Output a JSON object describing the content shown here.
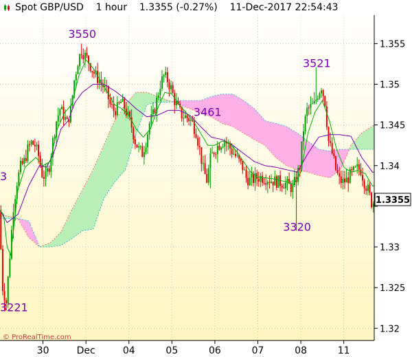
{
  "header": {
    "symbol": "Spot GBP/USD",
    "timeframe": "1 hour",
    "price_change": "1.3355 (-0.27%)",
    "datetime": "11-Dec-2017 22:54:43"
  },
  "watermark": "© ProRealTime.com",
  "last_price_label": "1.3355",
  "colors": {
    "up_candle": "#00a000",
    "down_candle": "#e00000",
    "kijun": "#7a00b0",
    "tenkan": "#00b000",
    "cloud_bull": "#b8f0b8",
    "cloud_bear": "#ffb0e6",
    "senkou_a": "#ff7070",
    "senkou_b": "#40c0e0",
    "background_top": "#ffffff",
    "background_bottom": "#fff5c0",
    "annotation": "#7a00b0"
  },
  "chart_data": {
    "type": "candlestick",
    "title": "Spot GBP/USD",
    "ylim": [
      1.3185,
      1.3585
    ],
    "y_ticks": [
      1.32,
      1.325,
      1.33,
      1.335,
      1.34,
      1.345,
      1.35,
      1.355
    ],
    "y_tick_labels": [
      "1.32",
      "1.325",
      "1.33",
      "",
      "1.34",
      "1.345",
      "1.35",
      "1.355"
    ],
    "x_labels": [
      {
        "label": "30",
        "hour": 24
      },
      {
        "label": "Dec",
        "hour": 48
      },
      {
        "label": "04",
        "hour": 72
      },
      {
        "label": "05",
        "hour": 96
      },
      {
        "label": "06",
        "hour": 120
      },
      {
        "label": "07",
        "hour": 144
      },
      {
        "label": "08",
        "hour": 168
      },
      {
        "label": "11",
        "hour": 192
      }
    ],
    "x_range_hours": [
      0,
      209
    ],
    "annotations": [
      {
        "label": "3550",
        "hour": 45,
        "price": 1.3557
      },
      {
        "label": "3221",
        "hour": 2,
        "price": 1.3221
      },
      {
        "label": "3461",
        "hour": 115,
        "price": 1.3461
      },
      {
        "label": "3320",
        "hour": 165,
        "price": 1.332
      },
      {
        "label": "3521",
        "hour": 176,
        "price": 1.3521
      },
      {
        "label": "3",
        "hour": 0,
        "price": 1.3382
      }
    ],
    "last_price": 1.3355,
    "close_path": [
      [
        0,
        1.3345
      ],
      [
        2,
        1.325
      ],
      [
        4,
        1.3232
      ],
      [
        6,
        1.329
      ],
      [
        8,
        1.335
      ],
      [
        10,
        1.338
      ],
      [
        12,
        1.3398
      ],
      [
        14,
        1.3405
      ],
      [
        16,
        1.342
      ],
      [
        18,
        1.3428
      ],
      [
        20,
        1.3425
      ],
      [
        22,
        1.3412
      ],
      [
        24,
        1.339
      ],
      [
        26,
        1.3385
      ],
      [
        28,
        1.34
      ],
      [
        30,
        1.343
      ],
      [
        32,
        1.3455
      ],
      [
        34,
        1.347
      ],
      [
        36,
        1.3462
      ],
      [
        38,
        1.3452
      ],
      [
        40,
        1.3468
      ],
      [
        42,
        1.3505
      ],
      [
        44,
        1.3528
      ],
      [
        46,
        1.3542
      ],
      [
        48,
        1.3535
      ],
      [
        50,
        1.3528
      ],
      [
        52,
        1.3518
      ],
      [
        54,
        1.351
      ],
      [
        56,
        1.3505
      ],
      [
        58,
        1.3498
      ],
      [
        60,
        1.349
      ],
      [
        62,
        1.3475
      ],
      [
        64,
        1.3468
      ],
      [
        66,
        1.347
      ],
      [
        68,
        1.3478
      ],
      [
        70,
        1.3472
      ],
      [
        72,
        1.346
      ],
      [
        74,
        1.3448
      ],
      [
        76,
        1.343
      ],
      [
        78,
        1.342
      ],
      [
        80,
        1.3415
      ],
      [
        82,
        1.343
      ],
      [
        84,
        1.3452
      ],
      [
        86,
        1.3462
      ],
      [
        88,
        1.348
      ],
      [
        90,
        1.35
      ],
      [
        92,
        1.351
      ],
      [
        94,
        1.3505
      ],
      [
        96,
        1.3495
      ],
      [
        98,
        1.348
      ],
      [
        100,
        1.347
      ],
      [
        102,
        1.3462
      ],
      [
        104,
        1.346
      ],
      [
        106,
        1.3458
      ],
      [
        108,
        1.3452
      ],
      [
        110,
        1.3442
      ],
      [
        112,
        1.342
      ],
      [
        114,
        1.3395
      ],
      [
        116,
        1.3382
      ],
      [
        118,
        1.3408
      ],
      [
        120,
        1.3418
      ],
      [
        122,
        1.3424
      ],
      [
        124,
        1.3428
      ],
      [
        126,
        1.3431
      ],
      [
        128,
        1.3425
      ],
      [
        130,
        1.3418
      ],
      [
        132,
        1.3412
      ],
      [
        134,
        1.3405
      ],
      [
        136,
        1.3398
      ],
      [
        138,
        1.3385
      ],
      [
        140,
        1.3382
      ],
      [
        142,
        1.3383
      ],
      [
        144,
        1.3385
      ],
      [
        146,
        1.3386
      ],
      [
        148,
        1.3385
      ],
      [
        150,
        1.3384
      ],
      [
        152,
        1.3382
      ],
      [
        154,
        1.3381
      ],
      [
        156,
        1.338
      ],
      [
        158,
        1.3379
      ],
      [
        160,
        1.3378
      ],
      [
        162,
        1.3375
      ],
      [
        164,
        1.3372
      ],
      [
        166,
        1.3385
      ],
      [
        168,
        1.34
      ],
      [
        170,
        1.3445
      ],
      [
        172,
        1.3468
      ],
      [
        174,
        1.3472
      ],
      [
        176,
        1.3475
      ],
      [
        178,
        1.3488
      ],
      [
        180,
        1.3498
      ],
      [
        182,
        1.3478
      ],
      [
        184,
        1.343
      ],
      [
        186,
        1.3415
      ],
      [
        188,
        1.3395
      ],
      [
        190,
        1.3382
      ],
      [
        192,
        1.338
      ],
      [
        194,
        1.3382
      ],
      [
        196,
        1.3388
      ],
      [
        198,
        1.3392
      ],
      [
        200,
        1.3396
      ],
      [
        202,
        1.3395
      ],
      [
        204,
        1.338
      ],
      [
        206,
        1.337
      ],
      [
        208,
        1.3355
      ]
    ],
    "tenkan_path": [
      [
        0,
        1.3345
      ],
      [
        2,
        1.334
      ],
      [
        4,
        1.33
      ],
      [
        6,
        1.329
      ],
      [
        8,
        1.333
      ],
      [
        10,
        1.337
      ],
      [
        14,
        1.3398
      ],
      [
        20,
        1.341
      ],
      [
        24,
        1.34
      ],
      [
        28,
        1.3405
      ],
      [
        32,
        1.3445
      ],
      [
        36,
        1.3465
      ],
      [
        40,
        1.3475
      ],
      [
        44,
        1.351
      ],
      [
        48,
        1.353
      ],
      [
        52,
        1.352
      ],
      [
        56,
        1.3505
      ],
      [
        60,
        1.349
      ],
      [
        64,
        1.3475
      ],
      [
        68,
        1.347
      ],
      [
        72,
        1.3462
      ],
      [
        76,
        1.3445
      ],
      [
        80,
        1.3435
      ],
      [
        84,
        1.3445
      ],
      [
        88,
        1.347
      ],
      [
        92,
        1.349
      ],
      [
        96,
        1.3488
      ],
      [
        100,
        1.3475
      ],
      [
        104,
        1.3465
      ],
      [
        108,
        1.3455
      ],
      [
        112,
        1.344
      ],
      [
        116,
        1.3425
      ],
      [
        120,
        1.3425
      ],
      [
        124,
        1.343
      ],
      [
        128,
        1.3428
      ],
      [
        132,
        1.3418
      ],
      [
        136,
        1.3405
      ],
      [
        140,
        1.3392
      ],
      [
        144,
        1.3386
      ],
      [
        148,
        1.3385
      ],
      [
        152,
        1.3384
      ],
      [
        156,
        1.3382
      ],
      [
        160,
        1.338
      ],
      [
        164,
        1.3377
      ],
      [
        168,
        1.3392
      ],
      [
        172,
        1.344
      ],
      [
        176,
        1.3466
      ],
      [
        180,
        1.348
      ],
      [
        184,
        1.3455
      ],
      [
        188,
        1.342
      ],
      [
        192,
        1.3398
      ],
      [
        196,
        1.3392
      ],
      [
        200,
        1.3394
      ],
      [
        204,
        1.339
      ],
      [
        208,
        1.3375
      ]
    ],
    "kijun_path": [
      [
        0,
        1.3345
      ],
      [
        4,
        1.333
      ],
      [
        10,
        1.334
      ],
      [
        16,
        1.3375
      ],
      [
        22,
        1.34
      ],
      [
        26,
        1.3398
      ],
      [
        30,
        1.3415
      ],
      [
        34,
        1.3445
      ],
      [
        38,
        1.3455
      ],
      [
        42,
        1.3478
      ],
      [
        46,
        1.349
      ],
      [
        52,
        1.35
      ],
      [
        58,
        1.35
      ],
      [
        64,
        1.3492
      ],
      [
        70,
        1.3482
      ],
      [
        76,
        1.347
      ],
      [
        82,
        1.346
      ],
      [
        88,
        1.3462
      ],
      [
        94,
        1.3468
      ],
      [
        100,
        1.3468
      ],
      [
        106,
        1.3462
      ],
      [
        112,
        1.3448
      ],
      [
        118,
        1.3435
      ],
      [
        124,
        1.3432
      ],
      [
        130,
        1.3425
      ],
      [
        136,
        1.3415
      ],
      [
        142,
        1.3405
      ],
      [
        148,
        1.34
      ],
      [
        154,
        1.3398
      ],
      [
        160,
        1.3395
      ],
      [
        166,
        1.3392
      ],
      [
        172,
        1.3415
      ],
      [
        178,
        1.3435
      ],
      [
        184,
        1.3438
      ],
      [
        190,
        1.3438
      ],
      [
        196,
        1.3436
      ],
      [
        202,
        1.341
      ],
      [
        208,
        1.3392
      ]
    ],
    "senkou_a_path": [
      [
        0,
        1.334
      ],
      [
        10,
        1.3335
      ],
      [
        16,
        1.3312
      ],
      [
        22,
        1.33
      ],
      [
        28,
        1.3305
      ],
      [
        34,
        1.3318
      ],
      [
        40,
        1.3345
      ],
      [
        46,
        1.337
      ],
      [
        52,
        1.3395
      ],
      [
        58,
        1.3425
      ],
      [
        64,
        1.3455
      ],
      [
        70,
        1.3475
      ],
      [
        76,
        1.349
      ],
      [
        82,
        1.349
      ],
      [
        88,
        1.3485
      ],
      [
        94,
        1.348
      ],
      [
        100,
        1.3475
      ],
      [
        106,
        1.347
      ],
      [
        112,
        1.3465
      ],
      [
        118,
        1.346
      ],
      [
        124,
        1.3452
      ],
      [
        130,
        1.3448
      ],
      [
        136,
        1.344
      ],
      [
        142,
        1.3432
      ],
      [
        148,
        1.3425
      ],
      [
        154,
        1.341
      ],
      [
        160,
        1.34
      ],
      [
        166,
        1.3395
      ],
      [
        172,
        1.3392
      ],
      [
        178,
        1.3388
      ],
      [
        184,
        1.3385
      ],
      [
        190,
        1.3395
      ],
      [
        196,
        1.3425
      ],
      [
        202,
        1.344
      ],
      [
        209,
        1.345
      ]
    ],
    "senkou_b_path": [
      [
        0,
        1.3335
      ],
      [
        10,
        1.3335
      ],
      [
        16,
        1.3332
      ],
      [
        22,
        1.33
      ],
      [
        28,
        1.33
      ],
      [
        34,
        1.3302
      ],
      [
        40,
        1.331
      ],
      [
        46,
        1.332
      ],
      [
        52,
        1.3322
      ],
      [
        58,
        1.336
      ],
      [
        64,
        1.338
      ],
      [
        70,
        1.3395
      ],
      [
        76,
        1.344
      ],
      [
        82,
        1.3475
      ],
      [
        88,
        1.3478
      ],
      [
        94,
        1.3478
      ],
      [
        100,
        1.348
      ],
      [
        106,
        1.348
      ],
      [
        112,
        1.348
      ],
      [
        118,
        1.3485
      ],
      [
        124,
        1.3488
      ],
      [
        130,
        1.3488
      ],
      [
        136,
        1.348
      ],
      [
        142,
        1.347
      ],
      [
        148,
        1.3455
      ],
      [
        154,
        1.3452
      ],
      [
        160,
        1.3448
      ],
      [
        166,
        1.344
      ],
      [
        172,
        1.343
      ],
      [
        178,
        1.342
      ],
      [
        184,
        1.3418
      ],
      [
        190,
        1.342
      ],
      [
        196,
        1.342
      ],
      [
        202,
        1.342
      ],
      [
        209,
        1.342
      ]
    ],
    "spikes": [
      {
        "hour": 2,
        "low": 1.3221
      },
      {
        "hour": 45,
        "high": 1.355
      },
      {
        "hour": 165,
        "low": 1.332
      },
      {
        "hour": 176,
        "high": 1.3521
      },
      {
        "hour": 117,
        "low": 1.3372
      }
    ]
  }
}
